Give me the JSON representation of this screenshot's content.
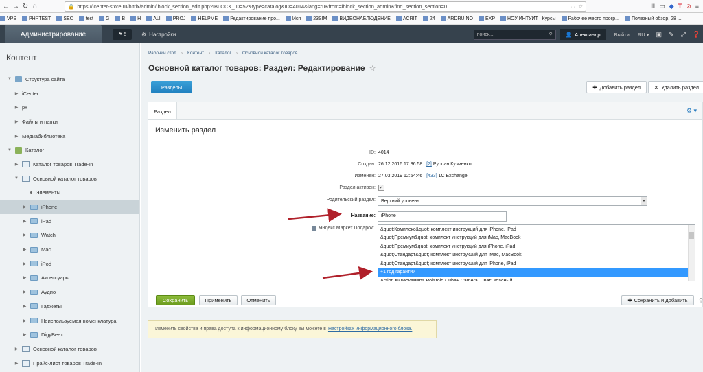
{
  "browser": {
    "url": "https://icenter-store.ru/bitrix/admin/iblock_section_edit.php?IBLOCK_ID=52&type=catalog&ID=4014&lang=ru&from=iblock_section_admin&find_section_section=0"
  },
  "bookmarks": [
    "VPS",
    "PHPTEST",
    "SEC",
    "test",
    "G",
    "B",
    "H",
    "ALI",
    "PROJ",
    "HELPME",
    "Редактирование про...",
    "Исп",
    "23SIM",
    "ВИДЕОНАБЛЮДЕНИЕ",
    "ACRIT",
    "24",
    "ARDRUINO",
    "EXP",
    "НОУ ИНТУИТ | Курсы",
    "Рабочее место прогр...",
    "Полезный обзор. 28 ..."
  ],
  "admin_bar": {
    "admin_tab": "Администрирование",
    "notif_count": "5",
    "settings": "Настройки",
    "search_placeholder": "поиск...",
    "user": "Александр",
    "logout": "Выйти",
    "lang": "RU"
  },
  "sidebar": {
    "title": "Контент",
    "items": [
      {
        "label": "Структура сайта",
        "level": 0,
        "icon": "site",
        "arrow": "▼"
      },
      {
        "label": "iCenter",
        "level": 1,
        "icon": "none",
        "arrow": "▶"
      },
      {
        "label": "px",
        "level": 1,
        "icon": "none",
        "arrow": "▶"
      },
      {
        "label": "Файлы и папки",
        "level": 1,
        "icon": "none",
        "arrow": "▶"
      },
      {
        "label": "Медиабиблиотека",
        "level": 1,
        "icon": "none",
        "arrow": "▶"
      },
      {
        "label": "Каталог",
        "level": 0,
        "icon": "grid",
        "arrow": "▼"
      },
      {
        "label": "Каталог товаров Trade-In",
        "level": 1,
        "icon": "cat",
        "arrow": "▶"
      },
      {
        "label": "Основной каталог товаров",
        "level": 1,
        "icon": "cat",
        "arrow": "▼"
      },
      {
        "label": "Элементы",
        "level": 2,
        "icon": "dot",
        "arrow": ""
      },
      {
        "label": "iPhone",
        "level": 2,
        "icon": "folder",
        "arrow": "▶",
        "active": true
      },
      {
        "label": "iPad",
        "level": 2,
        "icon": "folder",
        "arrow": "▶"
      },
      {
        "label": "Watch",
        "level": 2,
        "icon": "folder",
        "arrow": "▶"
      },
      {
        "label": "Mac",
        "level": 2,
        "icon": "folder",
        "arrow": "▶"
      },
      {
        "label": "iPod",
        "level": 2,
        "icon": "folder",
        "arrow": "▶"
      },
      {
        "label": "Аксессуары",
        "level": 2,
        "icon": "folder",
        "arrow": "▶"
      },
      {
        "label": "Аудио",
        "level": 2,
        "icon": "folder",
        "arrow": "▶"
      },
      {
        "label": "Гаджеты",
        "level": 2,
        "icon": "folder",
        "arrow": "▶"
      },
      {
        "label": "Неиспользуемая номенклатура",
        "level": 2,
        "icon": "folder",
        "arrow": "▶"
      },
      {
        "label": "DigyBeex",
        "level": 2,
        "icon": "folder",
        "arrow": "▶"
      },
      {
        "label": "Основной каталог товаров",
        "level": 1,
        "icon": "cat",
        "arrow": "▶"
      },
      {
        "label": "Прайс-лист товаров Trade-In",
        "level": 1,
        "icon": "cat",
        "arrow": "▶"
      }
    ]
  },
  "breadcrumb": [
    "Рабочий стол",
    "Контент",
    "Каталог",
    "Основной каталог товаров"
  ],
  "page_title": "Основной каталог товаров: Раздел: Редактирование",
  "toolbar": {
    "sections": "Разделы",
    "add_section": "Добавить раздел",
    "delete_section": "Удалить раздел"
  },
  "tab_label": "Раздел",
  "form": {
    "heading": "Изменить раздел",
    "id_label": "ID:",
    "id_value": "4014",
    "created_label": "Создан:",
    "created_date": "26.12.2016 17:36:58",
    "created_user_id": "[2]",
    "created_user": "Руслан Кузменко",
    "changed_label": "Изменен:",
    "changed_date": "27.03.2019 12:54:46",
    "changed_user_id": "[433]",
    "changed_user": "1C Exchange",
    "active_label": "Раздел активен:",
    "parent_label": "Родительский раздел:",
    "parent_value": "Верхний уровень",
    "name_label": "Название:",
    "name_value": "iPhone",
    "market_label": "Яндекс Маркет Подарок:",
    "market_options": [
      {
        "text": "&quot;Комплекс&quot; комплект инструкций для iPhone, iPad",
        "selected": false
      },
      {
        "text": "&quot;Премиум&quot; комплект инструкций для iMac, MacBook",
        "selected": false
      },
      {
        "text": "&quot;Премиум&quot; комплект инструкций для iPhone, iPad",
        "selected": false
      },
      {
        "text": "&quot;Стандарт&quot; комплект инструкций для iMac, MacBook",
        "selected": false
      },
      {
        "text": "&quot;Стандарт&quot; комплект инструкций для iPhone, iPad",
        "selected": false
      },
      {
        "text": "+1 год гарантии",
        "selected": true
      },
      {
        "text": "Action видеокамера Polaroid Cube+ Camera, Цвет: красный",
        "selected": false
      }
    ]
  },
  "buttons": {
    "save": "Сохранить",
    "apply": "Применить",
    "cancel": "Отменить",
    "save_add": "Сохранить и добавить"
  },
  "notice": {
    "text": "Изменить свойства и права доступа к информационному блоку вы можете в",
    "link": "Настройках информационного блока."
  },
  "colors": {
    "admin_bar": "#36424d",
    "save_button": "#7aa82a",
    "selected_option": "#3399ff",
    "arrow": "#b0202a"
  }
}
